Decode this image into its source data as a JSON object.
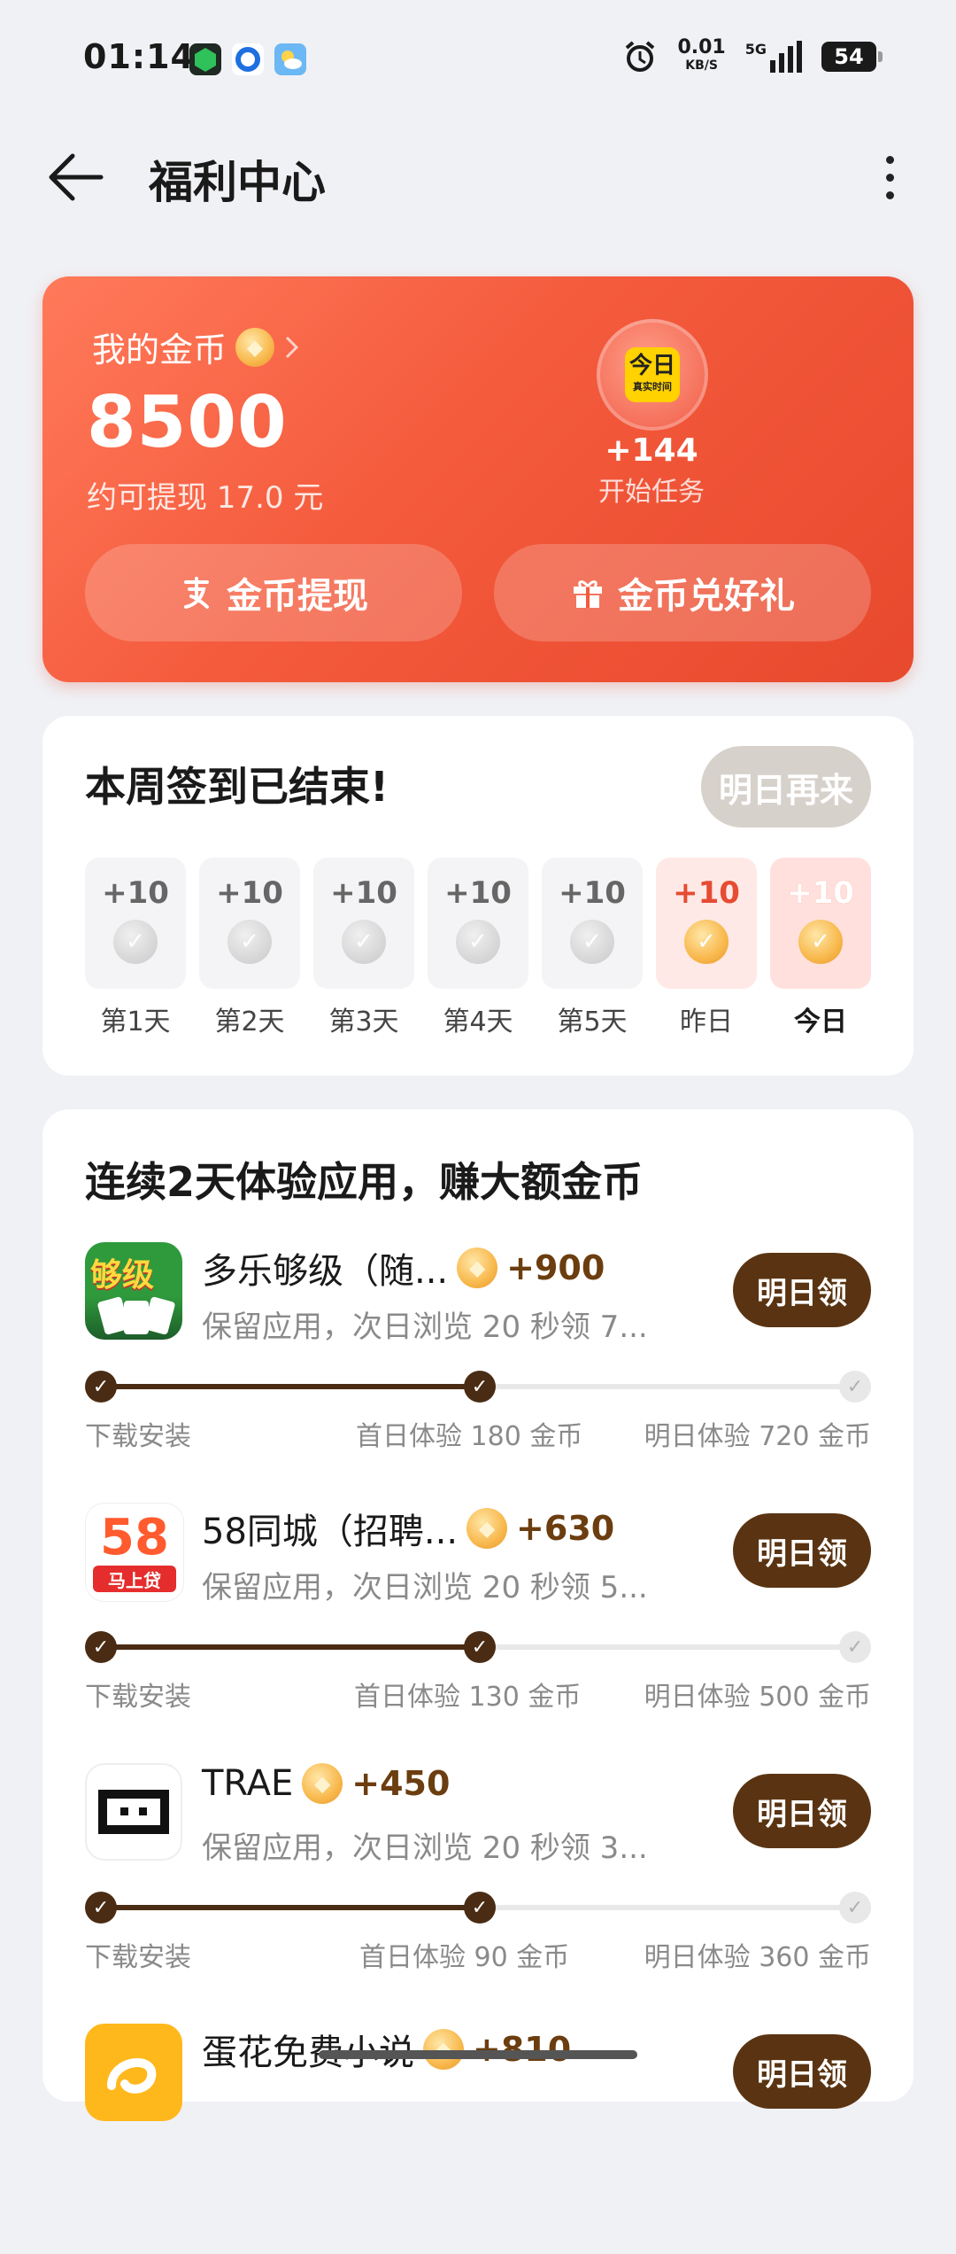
{
  "status_bar": {
    "time": "01:14",
    "net_speed": "0.01",
    "net_unit": "KB/S",
    "signal": "5G",
    "battery": "54",
    "icons": [
      "app-icon-green",
      "app-icon-blue",
      "weather-icon",
      "alarm-icon",
      "signal-icon",
      "battery-icon"
    ]
  },
  "header": {
    "title": "福利中心"
  },
  "coins": {
    "label": "我的金币",
    "value": "8500",
    "withdraw_estimate": "约可提现 17.0 元",
    "task_bonus": "+144",
    "task_start": "开始任务",
    "task_icon_top": "今日",
    "task_icon_bottom": "真实时间",
    "withdraw_button": "金币提现",
    "gift_button": "金币兑好礼"
  },
  "checkin": {
    "title": "本周签到已结束!",
    "button": "明日再来",
    "days": [
      {
        "points": "+10",
        "label": "第1天"
      },
      {
        "points": "+10",
        "label": "第2天"
      },
      {
        "points": "+10",
        "label": "第3天"
      },
      {
        "points": "+10",
        "label": "第4天"
      },
      {
        "points": "+10",
        "label": "第5天"
      },
      {
        "points": "+10",
        "label": "昨日"
      },
      {
        "points": "+10",
        "label": "今日"
      }
    ]
  },
  "experience": {
    "title": "连续2天体验应用，赚大额金币",
    "claim_label": "明日领",
    "tasks": [
      {
        "name": "多乐够级（随...",
        "bonus": "+900",
        "desc": "保留应用，次日浏览 20 秒领 7...",
        "step1": "下载安装",
        "step2": "首日体验 180 金币",
        "step3": "明日体验 720 金币",
        "icon_text": "够级"
      },
      {
        "name": "58同城（招聘...",
        "bonus": "+630",
        "desc": "保留应用，次日浏览 20 秒领 5...",
        "step1": "下载安装",
        "step2": "首日体验 130 金币",
        "step3": "明日体验 500 金币",
        "icon_text": "58",
        "icon_sub": "马上贷"
      },
      {
        "name": "TRAE",
        "bonus": "+450",
        "desc": "保留应用，次日浏览 20 秒领 3...",
        "step1": "下载安装",
        "step2": "首日体验 90 金币",
        "step3": "明日体验 360 金币"
      },
      {
        "name": "蛋花免费小说",
        "bonus": "+810",
        "claim": "明日领"
      }
    ]
  },
  "colors": {
    "brand": "#f45a3c",
    "claim": "#5a3412",
    "progress": "#4a2c14"
  }
}
